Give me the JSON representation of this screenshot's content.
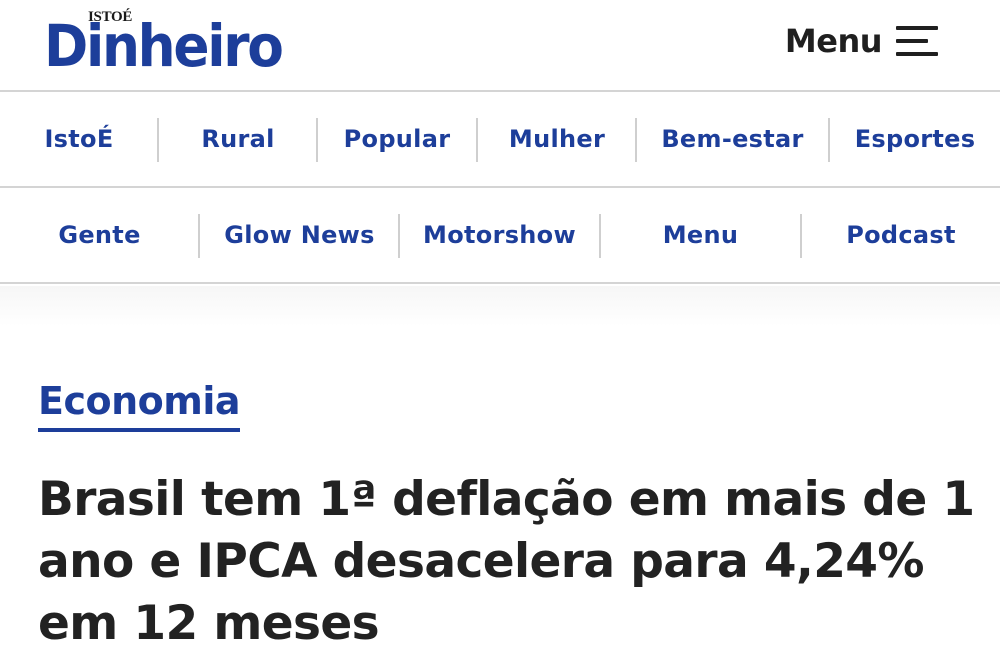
{
  "header": {
    "logo_top": "ISTOÉ",
    "logo_main": "Dinheiro",
    "menu_label": "Menu",
    "menu_icon": "hamburger-icon"
  },
  "nav": {
    "row1": [
      "IstoÉ",
      "Rural",
      "Popular",
      "Mulher",
      "Bem-estar",
      "Esportes"
    ],
    "row2": [
      "Gente",
      "Glow News",
      "Motorshow",
      "Menu",
      "Podcast"
    ]
  },
  "article": {
    "category": "Economia",
    "headline": "Brasil tem 1ª deflação em mais de 1 ano e IPCA desacelera para 4,24% em 12 meses"
  },
  "colors": {
    "brand_blue": "#1d3e9a",
    "text_dark": "#222222",
    "divider": "#d4d4d4"
  }
}
